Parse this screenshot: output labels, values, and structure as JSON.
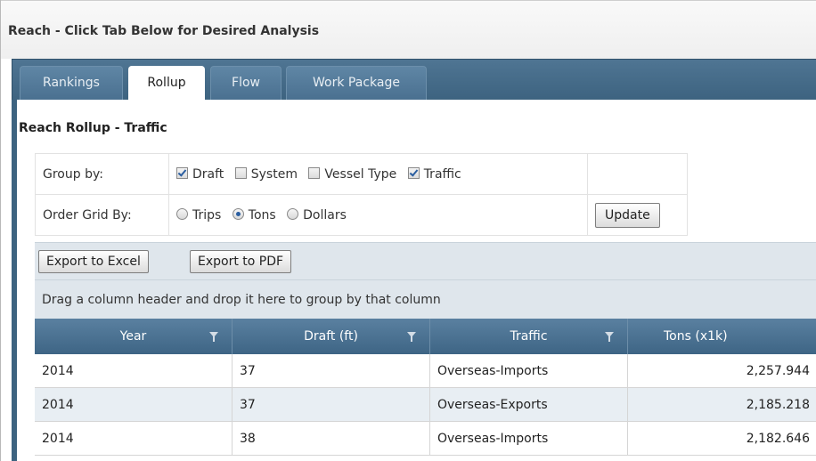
{
  "page": {
    "title": "Reach - Click Tab Below for Desired Analysis"
  },
  "tabs": [
    {
      "label": "Rankings",
      "active": false
    },
    {
      "label": "Rollup",
      "active": true
    },
    {
      "label": "Flow",
      "active": false
    },
    {
      "label": "Work Package",
      "active": false
    }
  ],
  "rollup": {
    "section_title": "Reach Rollup - Traffic",
    "group_by": {
      "label": "Group by:",
      "options": [
        {
          "label": "Draft",
          "checked": true
        },
        {
          "label": "System",
          "checked": false
        },
        {
          "label": "Vessel Type",
          "checked": false
        },
        {
          "label": "Traffic",
          "checked": true
        }
      ]
    },
    "order_by": {
      "label": "Order Grid By:",
      "options": [
        {
          "label": "Trips",
          "selected": false
        },
        {
          "label": "Tons",
          "selected": true
        },
        {
          "label": "Dollars",
          "selected": false
        }
      ]
    },
    "update_label": "Update"
  },
  "grid": {
    "export_excel_label": "Export to Excel",
    "export_pdf_label": "Export to PDF",
    "group_hint": "Drag a column header and drop it here to group by that column",
    "columns": [
      "Year",
      "Draft (ft)",
      "Traffic",
      "Tons (x1k)"
    ],
    "rows": [
      [
        "2014",
        "37",
        "Overseas-Imports",
        "2,257.944"
      ],
      [
        "2014",
        "37",
        "Overseas-Exports",
        "2,185.218"
      ],
      [
        "2014",
        "38",
        "Overseas-Imports",
        "2,182.646"
      ]
    ]
  },
  "colors": {
    "header_blue": "#3e6585",
    "toolbar_bg": "#dfe6ec",
    "alt_row": "#e8eef3"
  }
}
